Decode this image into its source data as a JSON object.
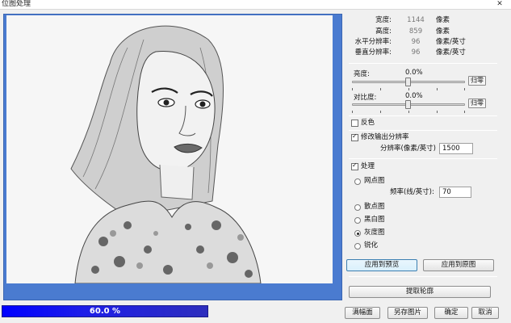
{
  "window": {
    "title": "位图处理",
    "close_glyph": "✕"
  },
  "progress": {
    "text": "60.0  %",
    "value_percent": 60.0
  },
  "info": {
    "rows": [
      {
        "label": "宽度:",
        "value": "1144",
        "unit": "像素"
      },
      {
        "label": "高度:",
        "value": "859",
        "unit": "像素"
      },
      {
        "label": "水平分辨率:",
        "value": "96",
        "unit": "像素/英寸"
      },
      {
        "label": "垂直分辨率:",
        "value": "96",
        "unit": "像素/英寸"
      }
    ]
  },
  "brightness": {
    "label": "亮度:",
    "value": "0.0%",
    "reset": "归零"
  },
  "contrast": {
    "label": "对比度:",
    "value": "0.0%",
    "reset": "归零"
  },
  "invert": {
    "label": "反色",
    "checked": false
  },
  "resolution": {
    "label": "修改输出分辨率",
    "checked": true,
    "field_label": "分辨率(像素/英寸)",
    "field_value": "1500"
  },
  "process": {
    "label": "处理",
    "checked": true,
    "options": [
      "网点图",
      "散点图",
      "黑白图",
      "灰度图",
      "锐化"
    ],
    "selected": "灰度图",
    "freq_label": "频率(线/英寸):",
    "freq_value": "70"
  },
  "buttons": {
    "apply_preview": "应用到预览",
    "apply_source": "应用到原图",
    "extract": "提取轮廓",
    "fit": "满幅面",
    "save_as": "另存图片",
    "ok": "确定",
    "cancel": "取消"
  },
  "colors": {
    "preview_frame": "#4a7bd0",
    "progress_fill": "#0000ff",
    "active_button": "#3c7fb1"
  }
}
